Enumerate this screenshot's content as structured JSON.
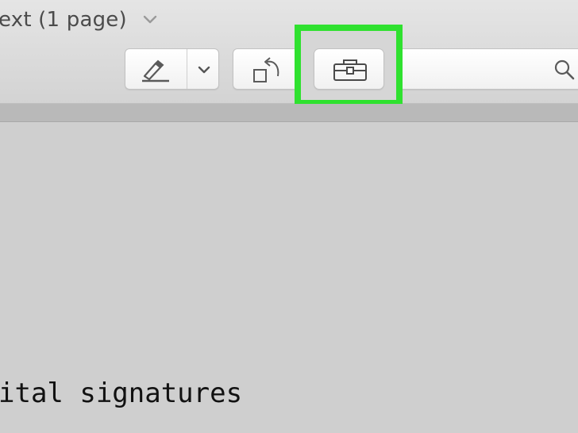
{
  "window": {
    "title": "ext (1 page)"
  },
  "toolbar": {
    "markup_button": "Markup",
    "markup_menu_button": "Markup options",
    "rotate_button": "Rotate",
    "toolbox_button": "Show Markup Toolbar",
    "search_placeholder": ""
  },
  "highlight": {
    "color": "#2fe12f"
  },
  "document": {
    "text": "ital signatures"
  },
  "icons": {
    "title_chevron": "chevron-down-icon",
    "markup": "pen-icon",
    "markup_dropdown": "chevron-down-icon",
    "rotate": "rotate-icon",
    "toolbox": "toolbox-icon",
    "search": "search-icon"
  }
}
